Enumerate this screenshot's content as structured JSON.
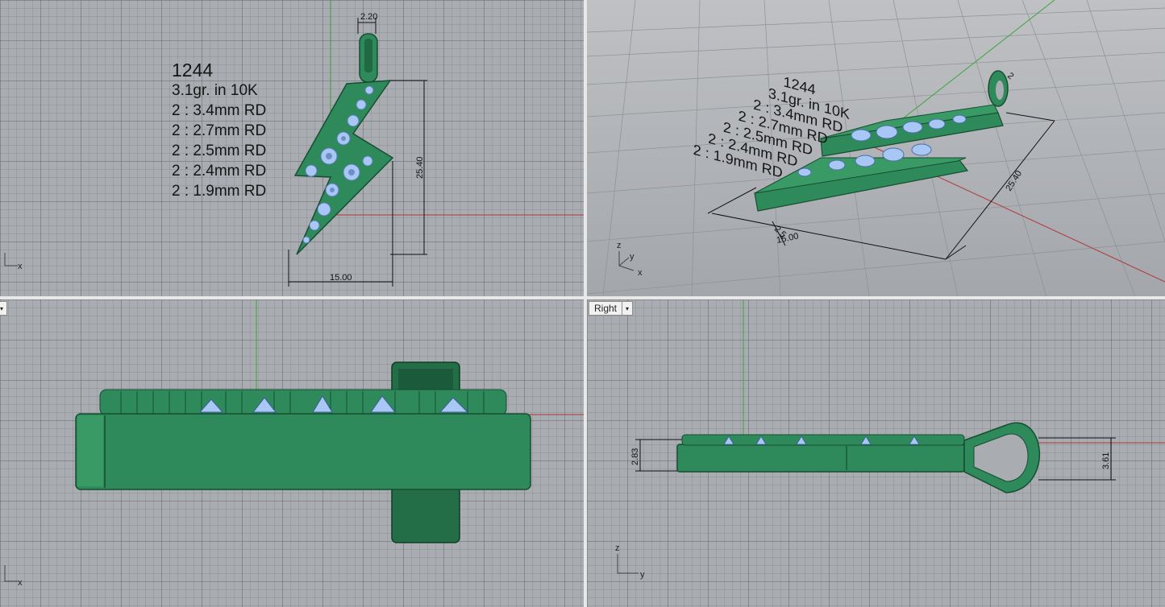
{
  "viewports": {
    "top": {
      "note": {
        "title": "1244",
        "lines": [
          "3.1gr.  in 10K",
          "2 : 3.4mm RD",
          "2 : 2.7mm RD",
          "2 : 2.5mm RD",
          "2 : 2.4mm RD",
          "2 : 1.9mm RD"
        ]
      },
      "dims": {
        "bail_width": "2.20",
        "height": "25.40",
        "width": "15.00"
      },
      "axis": "x"
    },
    "perspective": {
      "dims": {
        "length": "25.40",
        "small_a": "2.5",
        "small_b": "15.00",
        "small_c": "2"
      },
      "axes": [
        "z",
        "y",
        "x"
      ]
    },
    "front": {
      "label_arrow": "▾",
      "axis": "x"
    },
    "right": {
      "label": "Right",
      "label_arrow": "▾",
      "dims": {
        "thickness": "2.83",
        "bail_height": "3.61"
      },
      "axes": [
        "z",
        "y"
      ]
    }
  },
  "colors": {
    "background": "#a9acb1",
    "model": "#2e8a5a",
    "gems": "#a9c7f5",
    "x_axis": "#b03a3a",
    "y_axis": "#3aa63a"
  }
}
